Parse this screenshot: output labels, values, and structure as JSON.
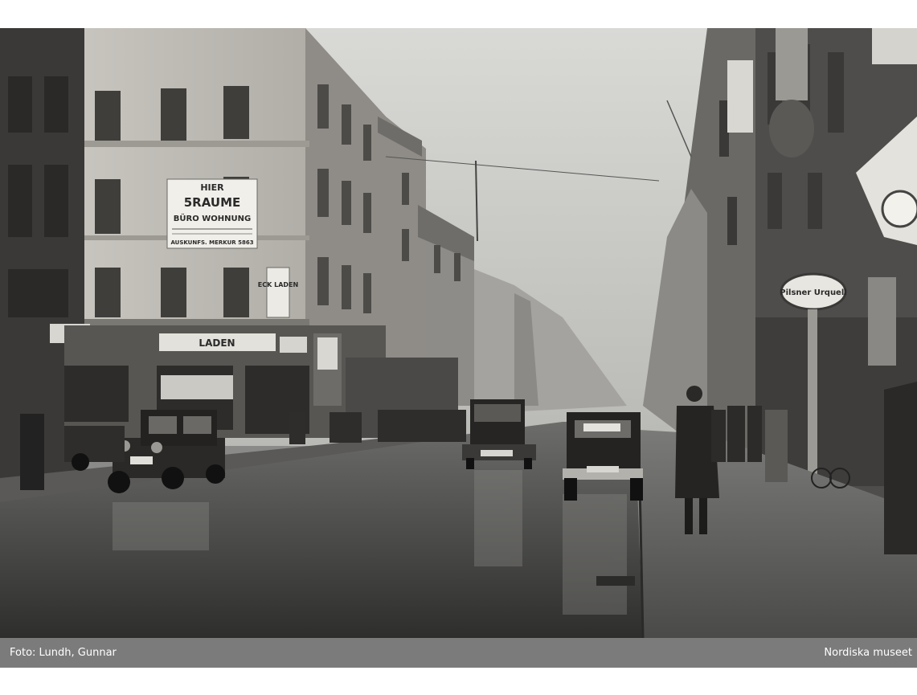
{
  "photo": {
    "signs": {
      "rental_hier": "HIER",
      "rental_raume": "5RAUME",
      "rental_buro": "BÜRO WOHNUNG",
      "rental_auskunft": "AUSKUNFS. MERKUR 5863",
      "laden": "LADEN",
      "eck_laden": "ECK LADEN",
      "pilsner": "Pilsner Urquell"
    }
  },
  "caption": {
    "credit": "Foto: Lundh, Gunnar",
    "source": "Nordiska museet"
  }
}
